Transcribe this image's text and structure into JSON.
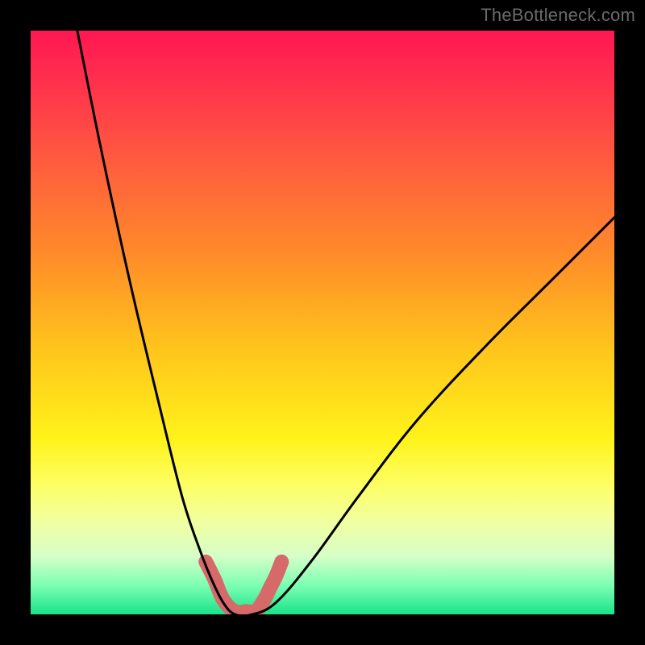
{
  "watermark": "TheBottleneck.com",
  "chart_data": {
    "type": "line",
    "title": "",
    "xlabel": "",
    "ylabel": "",
    "xlim": [
      0,
      100
    ],
    "ylim": [
      0,
      100
    ],
    "series": [
      {
        "name": "bottleneck-curve",
        "x": [
          8,
          12,
          17,
          22,
          26,
          29,
          31,
          33,
          35,
          38,
          42,
          48,
          56,
          66,
          78,
          90,
          100
        ],
        "values": [
          100,
          80,
          57,
          36,
          20,
          11,
          6,
          2,
          0,
          0,
          2,
          9,
          20,
          33,
          46,
          58,
          68
        ]
      },
      {
        "name": "highlight-band",
        "x": [
          30,
          31.5,
          33,
          35,
          37,
          38.5,
          40,
          41,
          42,
          43
        ],
        "values": [
          9,
          6,
          2.5,
          0.5,
          0.5,
          0.5,
          2.5,
          4.5,
          6.5,
          9
        ]
      }
    ],
    "colors": {
      "curve": "#000000",
      "highlight": "#d66a6a"
    }
  }
}
